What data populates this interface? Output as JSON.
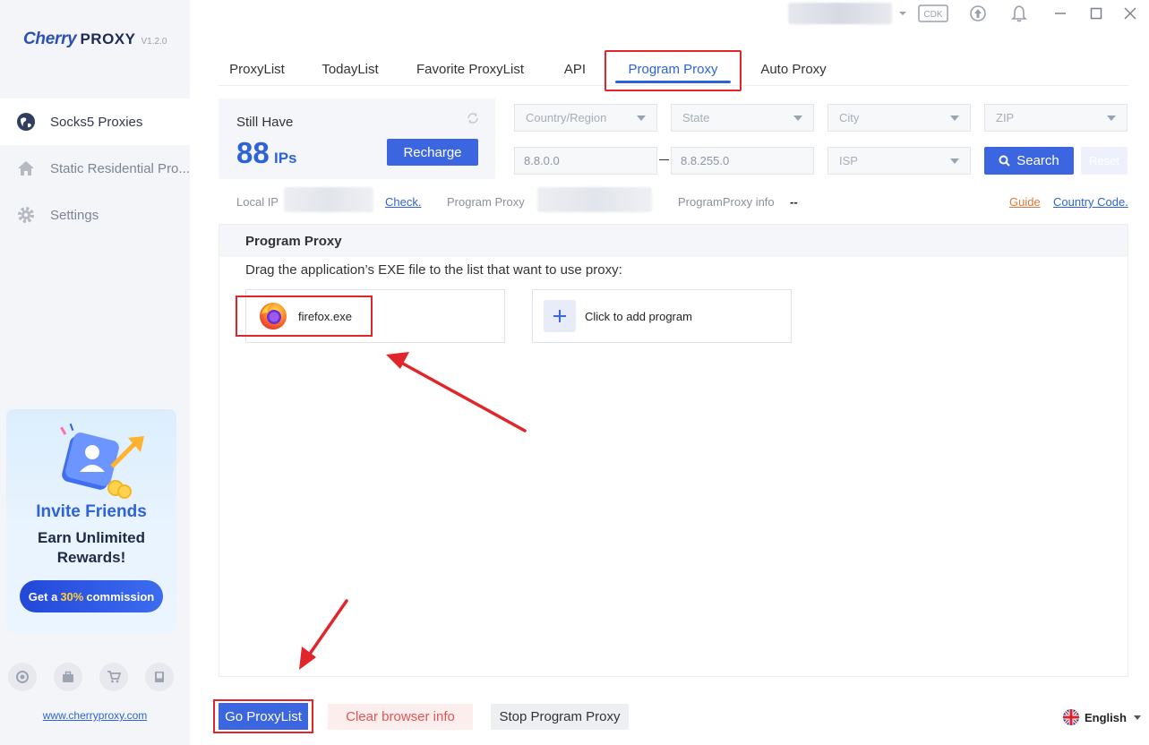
{
  "app": {
    "brand_main": "Cherry",
    "brand_second": "PROXY",
    "version": "V1.2.0",
    "website": "www.cherryproxy.com"
  },
  "titlebar": {
    "cdk_label": "CDK"
  },
  "sidebar": {
    "items": [
      {
        "label": "Socks5 Proxies",
        "icon": "globe-icon",
        "active": true
      },
      {
        "label": "Static Residential Pro...",
        "icon": "home-icon",
        "active": false
      },
      {
        "label": "Settings",
        "icon": "gear-icon",
        "active": false
      }
    ],
    "promo": {
      "title": "Invite Friends",
      "subtitle_line1": "Earn Unlimited",
      "subtitle_line2": "Rewards!",
      "cta_prefix": "Get a",
      "cta_highlight": "30%",
      "cta_suffix": "commission"
    }
  },
  "tabs": [
    {
      "label": "ProxyList"
    },
    {
      "label": "TodayList"
    },
    {
      "label": "Favorite ProxyList"
    },
    {
      "label": "API"
    },
    {
      "label": "Program Proxy",
      "active": true
    },
    {
      "label": "Auto Proxy"
    }
  ],
  "balance": {
    "label": "Still Have",
    "count": "88",
    "unit": "IPs",
    "recharge_label": "Recharge"
  },
  "filters": {
    "country": "Country/Region",
    "state": "State",
    "city": "City",
    "zip": "ZIP",
    "ip_from": "8.8.0.0",
    "ip_to": "8.8.255.0",
    "isp": "ISP",
    "search_label": "Search",
    "reset_label": "Reset"
  },
  "info": {
    "local_ip_label": "Local IP",
    "check_label": "Check.",
    "program_proxy_label": "Program Proxy",
    "program_proxy_info_label": "ProgramProxy info",
    "program_proxy_info_value": "--",
    "guide_label": "Guide",
    "country_code_label": "Country Code."
  },
  "panel": {
    "title": "Program Proxy",
    "instruction": "Drag the application’s EXE file to the list that want to use proxy:",
    "programs": [
      {
        "name": "firefox.exe"
      }
    ],
    "add_label": "Click to add program"
  },
  "actions": {
    "go_proxylist": "Go ProxyList",
    "clear_browser": "Clear browser info",
    "stop_program_proxy": "Stop Program Proxy"
  },
  "language": {
    "label": "English"
  },
  "colors": {
    "accent": "#3b66e0",
    "highlight": "#e0262b",
    "danger_text": "#e35454"
  }
}
